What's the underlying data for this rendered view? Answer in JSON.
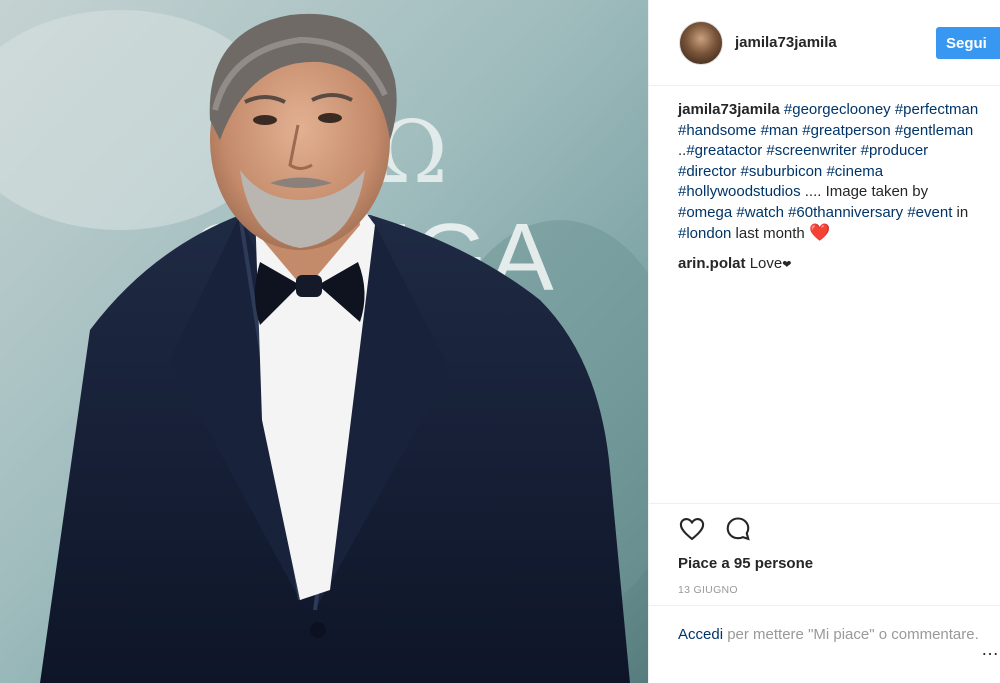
{
  "post": {
    "author": "jamila73jamila",
    "follow_label": "Segui",
    "caption_segments": [
      {
        "text": "#georgeclooney",
        "tag": true
      },
      {
        "text": " ",
        "tag": false
      },
      {
        "text": "#perfectman",
        "tag": true
      },
      {
        "text": " ",
        "tag": false
      },
      {
        "text": "#handsome",
        "tag": true
      },
      {
        "text": " ",
        "tag": false
      },
      {
        "text": "#man",
        "tag": true
      },
      {
        "text": " ",
        "tag": false
      },
      {
        "text": "#greatperson",
        "tag": true
      },
      {
        "text": " ",
        "tag": false
      },
      {
        "text": "#gentleman",
        "tag": true
      },
      {
        "text": " ..",
        "tag": false
      },
      {
        "text": "#greatactor",
        "tag": true
      },
      {
        "text": " ",
        "tag": false
      },
      {
        "text": "#screenwriter",
        "tag": true
      },
      {
        "text": " ",
        "tag": false
      },
      {
        "text": "#producer",
        "tag": true
      },
      {
        "text": " ",
        "tag": false
      },
      {
        "text": "#director",
        "tag": true
      },
      {
        "text": " ",
        "tag": false
      },
      {
        "text": "#suburbicon",
        "tag": true
      },
      {
        "text": " ",
        "tag": false
      },
      {
        "text": "#cinema",
        "tag": true
      },
      {
        "text": " ",
        "tag": false
      },
      {
        "text": "#hollywoodstudios",
        "tag": true
      },
      {
        "text": " .... Image taken by ",
        "tag": false
      },
      {
        "text": "#omega",
        "tag": true
      },
      {
        "text": " ",
        "tag": false
      },
      {
        "text": "#watch",
        "tag": true
      },
      {
        "text": " ",
        "tag": false
      },
      {
        "text": "#60thanniversary",
        "tag": true
      },
      {
        "text": " ",
        "tag": false
      },
      {
        "text": "#event",
        "tag": true
      },
      {
        "text": " in ",
        "tag": false
      },
      {
        "text": "#london",
        "tag": true
      },
      {
        "text": " last month ",
        "tag": false
      }
    ],
    "caption_emoji": "❤️",
    "comments": [
      {
        "author": "arin.polat",
        "text": "Love",
        "emoji": "❤"
      }
    ],
    "likes_text": "Piace a 95 persone",
    "date": "13 GIUGNO",
    "login": {
      "link": "Accedi",
      "rest": " per mettere \"Mi piace\" o commentare."
    },
    "more_icon": "…"
  },
  "photo": {
    "logo_symbol": "Ω",
    "logo_word": "OMEGA"
  },
  "icons": {
    "like": "heart-outline-icon",
    "comment": "speech-bubble-icon"
  },
  "colors": {
    "accent": "#3897f0",
    "hashtag": "#003569",
    "muted": "#999999",
    "heart": "#e0245e"
  }
}
